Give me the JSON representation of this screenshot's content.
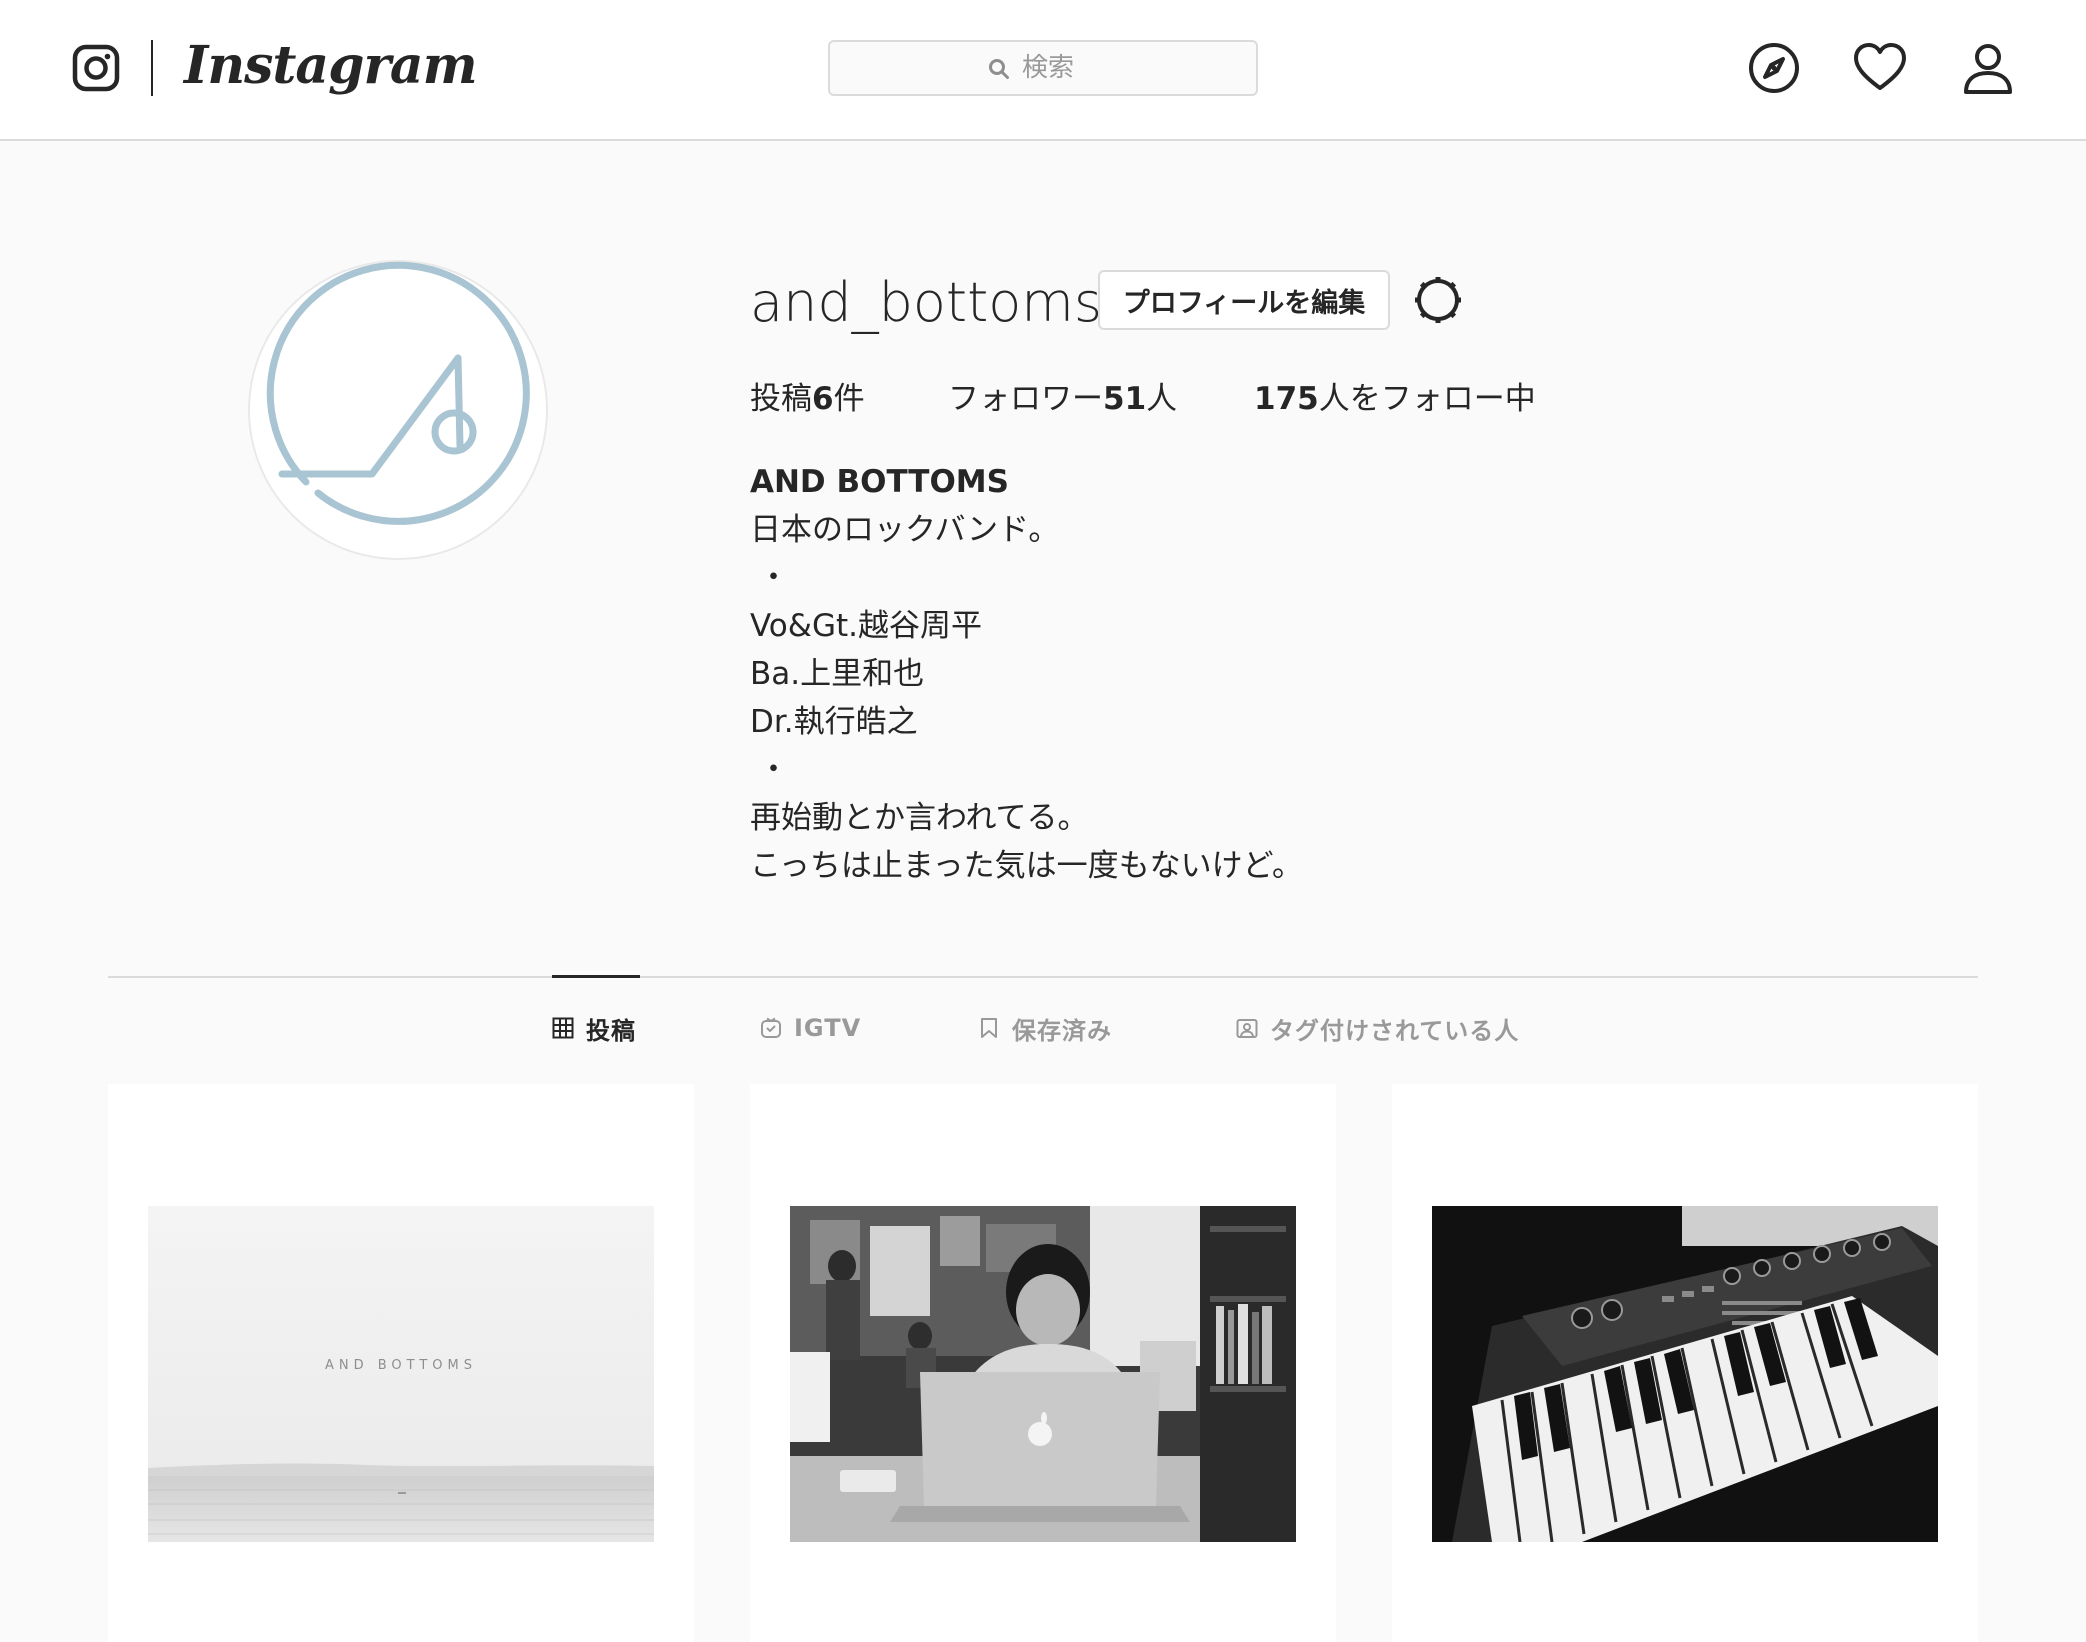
{
  "app": {
    "name": "Instagram"
  },
  "header": {
    "logo_text": "Instagram",
    "search": {
      "placeholder": "検索",
      "value": ""
    },
    "icons": [
      "instagram-glyph-icon",
      "search-icon",
      "compass-icon",
      "heart-icon",
      "person-icon"
    ]
  },
  "profile": {
    "username": "and_bottoms",
    "edit_button_label": "プロフィールを編集",
    "stats": {
      "posts_prefix": "投稿",
      "posts_count": "6",
      "posts_suffix": "件",
      "followers_prefix": "フォロワー",
      "followers_count": "51",
      "followers_suffix": "人",
      "following_count": "175",
      "following_suffix": "人をフォロー中"
    },
    "full_name": "AND BOTTOMS",
    "bio_lines": [
      "日本のロックバンド。",
      "・",
      "Vo&Gt.越谷周平",
      "Ba.上里和也",
      "Dr.執行皓之",
      "・",
      "再始動とか言われてる。",
      "こっちは止まった気は一度もないけど。"
    ]
  },
  "tabs": [
    {
      "label": "投稿",
      "icon": "grid-icon",
      "active": true
    },
    {
      "label": "IGTV",
      "icon": "igtv-icon",
      "active": false
    },
    {
      "label": "保存済み",
      "icon": "bookmark-icon",
      "active": false
    },
    {
      "label": "タグ付けされている人",
      "icon": "tagged-person-icon",
      "active": false
    }
  ],
  "posts": [
    {
      "description": "sea horizon",
      "overlay_text": "AND BOTTOMS"
    },
    {
      "description": "person at laptop"
    },
    {
      "description": "synthesizer keyboard"
    }
  ],
  "colors": {
    "background": "#fafafa",
    "text": "#262626",
    "muted": "#999999",
    "border": "#dbdbdb",
    "avatar_logo": "#a9c4d2"
  }
}
